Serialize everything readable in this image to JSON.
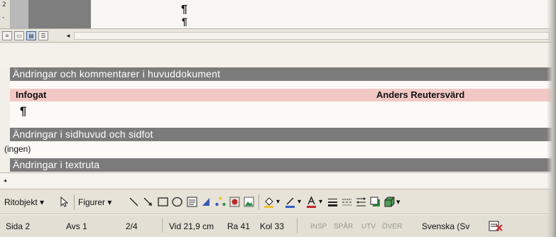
{
  "document_top": {
    "ruler_digits": [
      "2",
      "-"
    ],
    "pilcrow": "¶"
  },
  "view_bar": {
    "buttons": [
      {
        "name": "normal-view",
        "glyph": "≡"
      },
      {
        "name": "web-layout-view",
        "glyph": "▭"
      },
      {
        "name": "print-layout-view",
        "glyph": "▤"
      },
      {
        "name": "outline-view",
        "glyph": "☰"
      }
    ],
    "scroll_left_glyph": "◂"
  },
  "reviewing_pane": {
    "main_header": "Ändringar och kommentarer i huvuddokument",
    "insert_type": "Infogat",
    "insert_author": "Anders Reutersvärd",
    "pilcrow": "¶",
    "header_footer_header": "Ändringar i sidhuvud och sidfot",
    "none_text": "(ingen)",
    "textbox_header": "Ändringar i textruta",
    "scroll_left_glyph": "◂"
  },
  "drawing_toolbar": {
    "draw_menu": "Ritobjekt ▾",
    "shapes_menu": "Figurer ▾",
    "dropdown_glyph": "▾",
    "colors": {
      "fill": "#f1c232",
      "line": "#2f5fbf",
      "font": "#c0262a",
      "diagram_blue": "#3b58b8",
      "clipart_green": "#2f8f4e",
      "shadow_green": "#2b8f3a",
      "3d_green": "#4f9f57"
    }
  },
  "status_bar": {
    "page": "Sida 2",
    "section": "Avs 1",
    "page_of": "2/4",
    "position": "Vid 21,9 cm",
    "line": "Ra 41",
    "column": "Kol 33",
    "rec": "INSP",
    "trk": "SPÅR",
    "ext": "UTV",
    "ovr": "ÖVER",
    "language": "Svenska (Sv",
    "spelling_icon": "spelling-check-icon"
  }
}
